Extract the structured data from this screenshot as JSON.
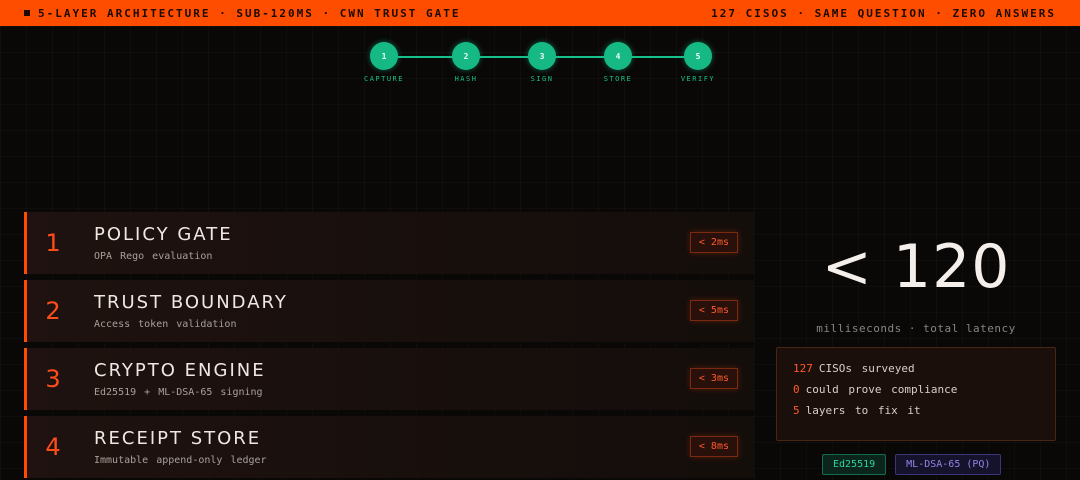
{
  "topbar": {
    "left_text": "5-LAYER ARCHITECTURE · SUB-120MS · CWN TRUST GATE",
    "right_text": "127 CISOS · SAME QUESTION · ZERO ANSWERS",
    "background": "#ff4d00"
  },
  "stepper": {
    "steps": [
      {
        "number": "1",
        "label": "CAPTURE"
      },
      {
        "number": "2",
        "label": "HASH"
      },
      {
        "number": "3",
        "label": "SIGN"
      },
      {
        "number": "4",
        "label": "STORE"
      },
      {
        "number": "5",
        "label": "VERIFY"
      }
    ],
    "color": "#16c08a"
  },
  "layers": [
    {
      "number": "1",
      "title": "POLICY GATE",
      "subtitle": "OPA Rego evaluation",
      "latency": "< 2ms"
    },
    {
      "number": "2",
      "title": "TRUST BOUNDARY",
      "subtitle": "Access token validation",
      "latency": "< 5ms"
    },
    {
      "number": "3",
      "title": "CRYPTO ENGINE",
      "subtitle": "Ed25519 + ML-DSA-65 signing",
      "latency": "< 3ms"
    },
    {
      "number": "4",
      "title": "RECEIPT STORE",
      "subtitle": "Immutable append-only ledger",
      "latency": "< 8ms"
    }
  ],
  "summary": {
    "big_value": "< 120",
    "caption": "milliseconds · total latency",
    "stats": [
      {
        "num": "127",
        "text": "CISOs surveyed"
      },
      {
        "num": "0",
        "text": "could prove compliance"
      },
      {
        "num": "5",
        "text": "layers to fix it"
      }
    ],
    "tags": [
      {
        "label": "Ed25519",
        "style": "green"
      },
      {
        "label": "ML-DSA-65 (PQ)",
        "style": "purple"
      }
    ]
  },
  "colors": {
    "accent": "#ff4d00",
    "success": "#16c08a",
    "pq": "#8f86e8"
  }
}
